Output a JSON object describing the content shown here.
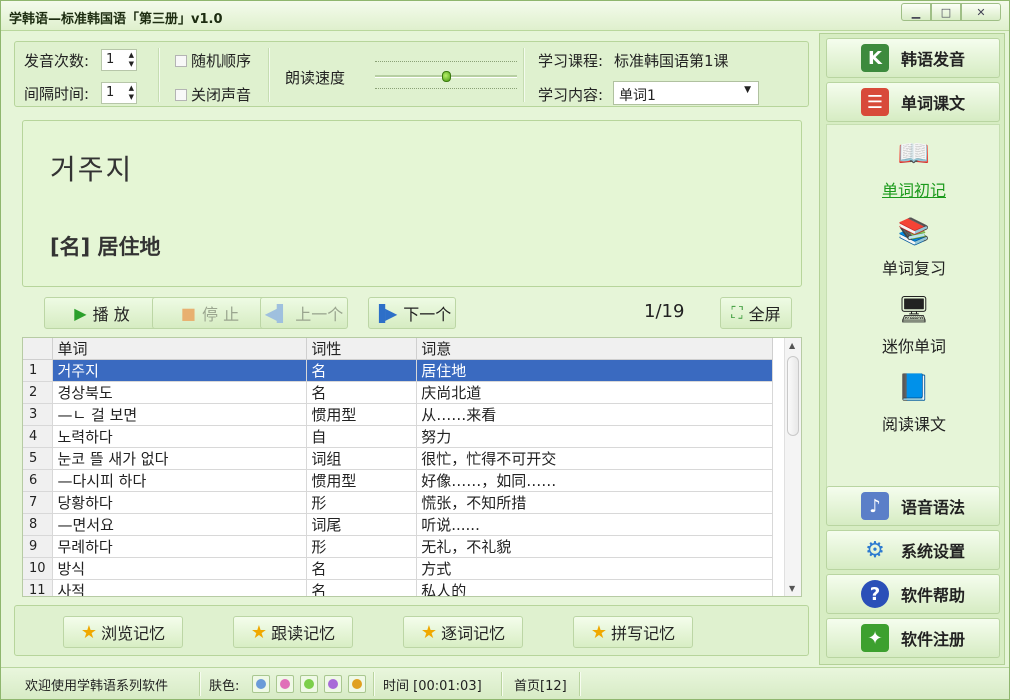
{
  "window": {
    "title": "学韩语—标准韩国语「第三册」v1.0"
  },
  "settings": {
    "pronounce_count_label": "发音次数:",
    "pronounce_count": "1",
    "interval_label": "间隔时间:",
    "interval_value": "1",
    "random_order": "随机顺序",
    "mute": "关闭声音",
    "read_speed_label": "朗读速度",
    "read_speed_level": 0.5,
    "course_label": "学习课程:",
    "course_value": "标准韩国语第1课",
    "content_label": "学习内容:",
    "content_value": "单词1"
  },
  "display": {
    "korean": "거주지",
    "chinese": "[名] 居住地"
  },
  "controls": {
    "play": "播 放",
    "stop": "停 止",
    "prev": "上一个",
    "next": "下一个",
    "counter": "1/19",
    "fullscreen": "全屏"
  },
  "table": {
    "headers": [
      "单词",
      "词性",
      "词意"
    ],
    "rows": [
      {
        "n": "1",
        "word": "거주지",
        "pos": "名",
        "meaning": "居住地"
      },
      {
        "n": "2",
        "word": "경상북도",
        "pos": "名",
        "meaning": "庆尚北道"
      },
      {
        "n": "3",
        "word": "—ㄴ 걸 보면",
        "pos": "惯用型",
        "meaning": "从……来看"
      },
      {
        "n": "4",
        "word": "노력하다",
        "pos": "自",
        "meaning": "努力"
      },
      {
        "n": "5",
        "word": "눈코 뜰 새가 없다",
        "pos": "词组",
        "meaning": "很忙，忙得不可开交"
      },
      {
        "n": "6",
        "word": "—다시피 하다",
        "pos": "惯用型",
        "meaning": "好像……，如同……"
      },
      {
        "n": "7",
        "word": "당황하다",
        "pos": "形",
        "meaning": "慌张，不知所措"
      },
      {
        "n": "8",
        "word": "—면서요",
        "pos": "词尾",
        "meaning": "听说......"
      },
      {
        "n": "9",
        "word": "무례하다",
        "pos": "形",
        "meaning": "无礼，不礼貌"
      },
      {
        "n": "10",
        "word": "방식",
        "pos": "名",
        "meaning": "方式"
      },
      {
        "n": "11",
        "word": "사적",
        "pos": "名",
        "meaning": "私人的"
      }
    ]
  },
  "memory_buttons": [
    "浏览记忆",
    "跟读记忆",
    "逐词记忆",
    "拼写记忆"
  ],
  "sidebar": {
    "korean_pronunciation": "韩语发音",
    "word_text": "单词课文",
    "sub_items": [
      "单词初记",
      "单词复习",
      "迷你单词",
      "阅读课文"
    ],
    "voice_grammar": "语音语法",
    "system_settings": "系统设置",
    "software_help": "软件帮助",
    "software_register": "软件注册"
  },
  "statusbar": {
    "welcome": "欢迎使用学韩语系列软件",
    "skin_label": "肤色:",
    "skin_colors": [
      "#6b9bd8",
      "#e070b8",
      "#7ccf4a",
      "#a86ad8",
      "#e0a020"
    ],
    "time": "时间 [00:01:03]",
    "home": "首页[12]"
  }
}
